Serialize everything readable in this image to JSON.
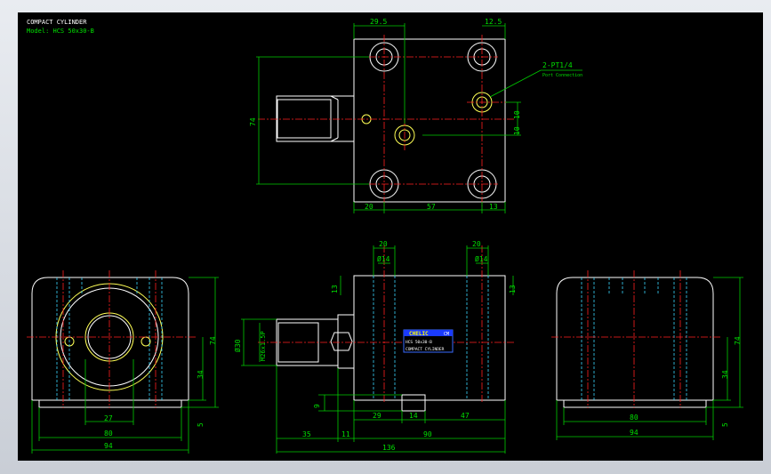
{
  "title_block": {
    "title": "COMPACT CYLINDER",
    "model": "Model: HCS 50x30-B"
  },
  "port_note": {
    "label": "2-PT1/4",
    "sublabel": "Port Connection"
  },
  "nameplate": {
    "brand": "CHELIC",
    "mark": "CM",
    "model": "HCS 50x30-B",
    "description": "COMPACT CYLINDER"
  },
  "dimensions": {
    "top_29_5": "29.5",
    "top_12_5": "12.5",
    "top_74": "74",
    "top_10a": "10",
    "top_10b": "10",
    "top_20": "20",
    "top_57": "57",
    "top_13": "13",
    "front_20a": "20",
    "front_20b": "20",
    "front_d14a": "Ø14",
    "front_d14b": "Ø14",
    "front_13a": "13",
    "front_13b": "13",
    "front_d30": "Ø30",
    "front_m26": "M26x1.5P",
    "front_9": "9",
    "front_29": "29",
    "front_14": "14",
    "front_47": "47",
    "front_35": "35",
    "front_11": "11",
    "front_90": "90",
    "front_136": "136",
    "left_74": "74",
    "left_34": "34",
    "left_5": "5",
    "left_27": "27",
    "left_80": "80",
    "left_94": "94",
    "right_74": "74",
    "right_34": "34",
    "right_5": "5",
    "right_80": "80",
    "right_94": "94"
  }
}
